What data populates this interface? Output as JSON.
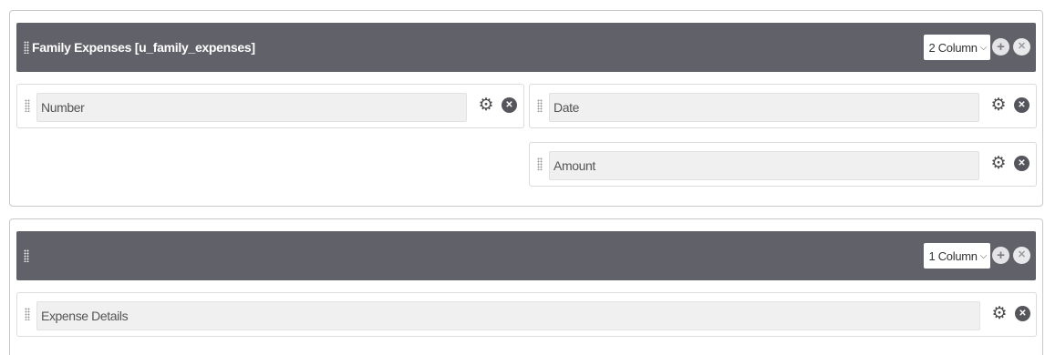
{
  "sections": [
    {
      "title": "Family Expenses [u_family_expenses]",
      "columns_label": "2 Column",
      "fields": [
        {
          "label": "Number"
        },
        {
          "label": "Date"
        },
        {
          "label": "Amount"
        }
      ]
    },
    {
      "title": "",
      "columns_label": "1 Column",
      "fields": [
        {
          "label": "Expense Details"
        }
      ]
    }
  ],
  "icons": {
    "drag_handle": "grip-icon",
    "add": "plus-circle-icon",
    "remove": "close-circle-icon",
    "settings": "gear-icon",
    "dropdown": "chevron-down-icon"
  },
  "colors": {
    "section_header": "#616169",
    "field_background": "#f0f0f0",
    "remove_button": "#55555c"
  }
}
